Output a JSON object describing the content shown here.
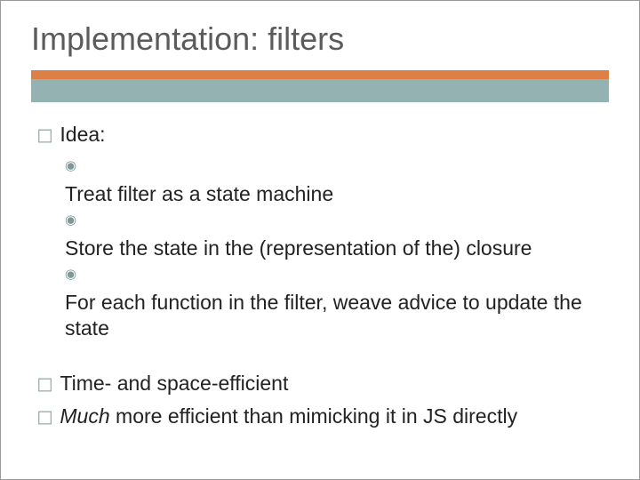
{
  "title": "Implementation: filters",
  "colors": {
    "accent": "#dd8046",
    "band": "#94b2b1"
  },
  "bullets": [
    {
      "label": "Idea:",
      "sub": [
        {
          "text": "Treat filter as a state machine"
        },
        {
          "text": "Store the state in the (representation of the) closure"
        },
        {
          "text": "For each function in the filter, weave advice to update the state"
        }
      ]
    },
    {
      "label": "Time- and space-efficient"
    },
    {
      "label_pre_italic": "Much",
      "label_rest": " more efficient than mimicking it in JS directly"
    }
  ]
}
